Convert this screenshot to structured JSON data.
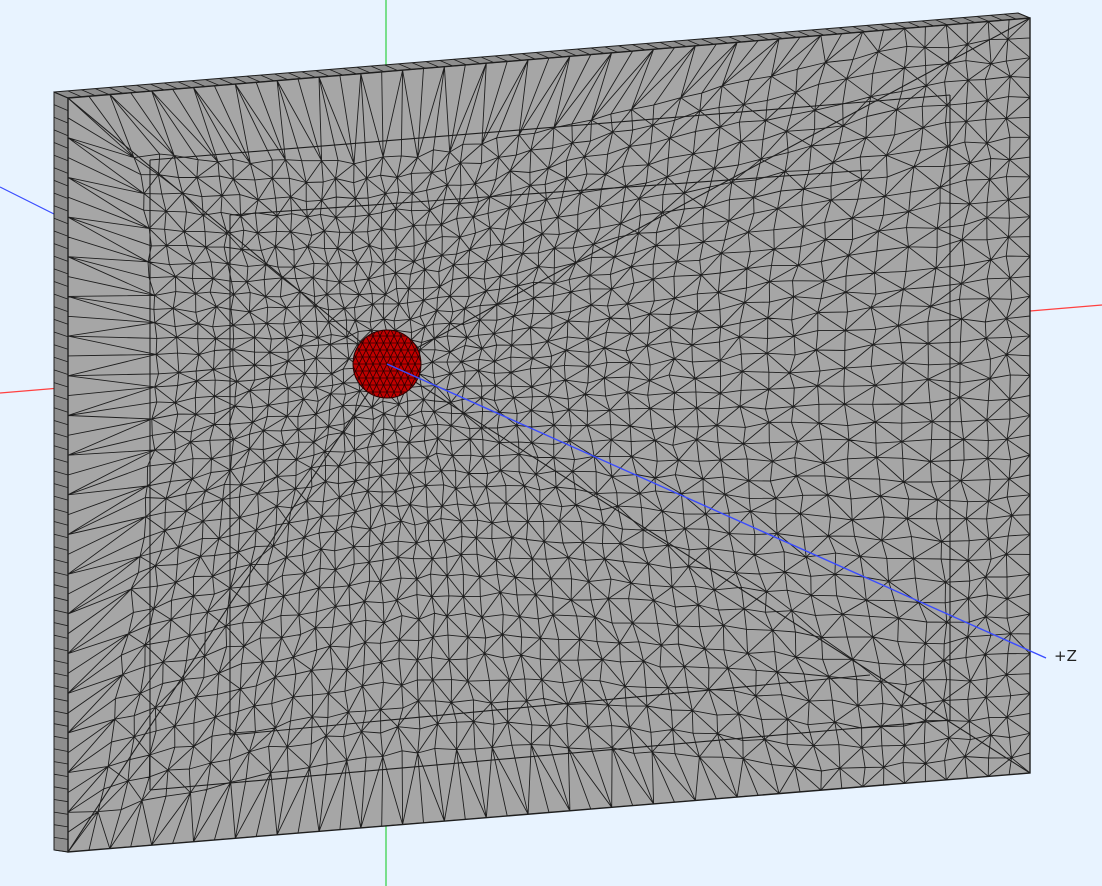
{
  "viewport": {
    "background_color": "#e8f3ff"
  },
  "axes": {
    "z_label": "+Z",
    "x_axis_color": "#ff4040",
    "y_axis_color": "#30d040",
    "z_axis_color": "#3a4cff"
  },
  "model": {
    "mesh_face_color": "#a6a6a6",
    "mesh_side_color": "#8e8e8e",
    "mesh_edge_color": "#1e1e1e",
    "selected_region_color": "#c00000",
    "selected_region_edge_color": "#2a0000"
  }
}
